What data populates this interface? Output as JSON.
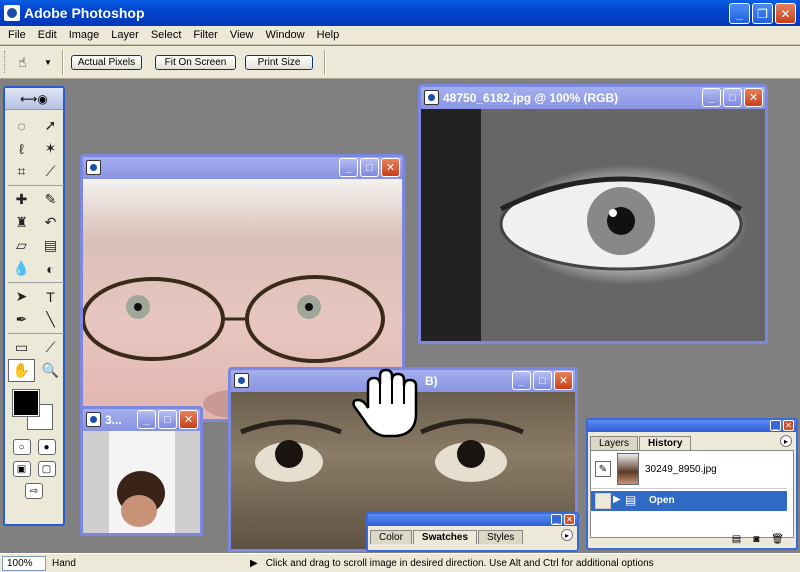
{
  "app": {
    "title": "Adobe Photoshop"
  },
  "menu": [
    "File",
    "Edit",
    "Image",
    "Layer",
    "Select",
    "Filter",
    "View",
    "Window",
    "Help"
  ],
  "options": {
    "actual_pixels": "Actual Pixels",
    "fit_on_screen": "Fit On Screen",
    "print_size": "Print Size"
  },
  "documents": {
    "eye": {
      "title": "48750_6182.jpg @ 100% (RGB)"
    },
    "face": {
      "title": ""
    },
    "small": {
      "title": "3..."
    },
    "brow": {
      "title": "B)"
    }
  },
  "swatches_panel": {
    "tabs": [
      "Color",
      "Swatches",
      "Styles"
    ],
    "active_tab": "Swatches"
  },
  "history_panel": {
    "tabs": [
      "Layers",
      "History"
    ],
    "active_tab": "History",
    "snapshot": "30249_8950.jpg",
    "step": "Open"
  },
  "status": {
    "zoom": "100%",
    "tool": "Hand",
    "hint": "Click and drag to scroll image in desired direction.  Use Alt and Ctrl for additional options"
  },
  "colors": {
    "titlebar": "#0a5ee4",
    "inactive_title": "#8894e2",
    "workspace": "#808080",
    "selection": "#316ac5"
  }
}
